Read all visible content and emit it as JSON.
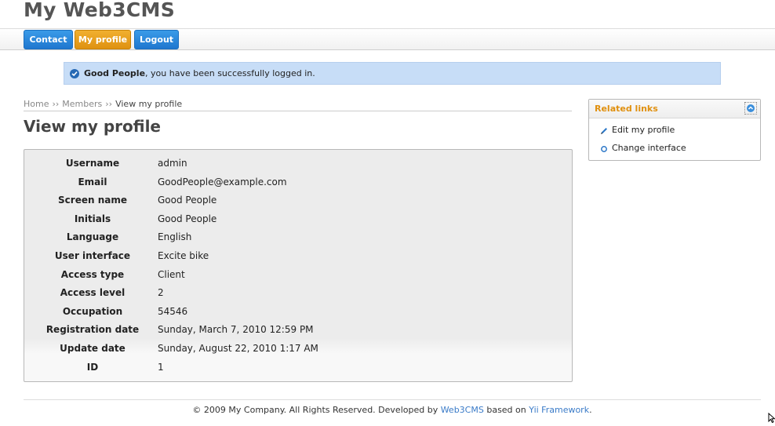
{
  "site": {
    "title": "My Web3CMS"
  },
  "menu": {
    "items": [
      "Contact",
      "My profile",
      "Logout"
    ]
  },
  "flash": {
    "name": "Good People",
    "message": ", you have been successfully logged in."
  },
  "breadcrumb": {
    "home": "Home",
    "members": "Members",
    "current": "View my profile",
    "separator": "››"
  },
  "page": {
    "title": "View my profile"
  },
  "profile": {
    "rows": [
      {
        "label": "Username",
        "value": "admin"
      },
      {
        "label": "Email",
        "value": "GoodPeople@example.com"
      },
      {
        "label": "Screen name",
        "value": "Good People"
      },
      {
        "label": "Initials",
        "value": "Good People"
      },
      {
        "label": "Language",
        "value": "English"
      },
      {
        "label": "User interface",
        "value": "Excite bike"
      },
      {
        "label": "Access type",
        "value": "Client"
      },
      {
        "label": "Access level",
        "value": "2"
      },
      {
        "label": "Occupation",
        "value": "54546"
      },
      {
        "label": "Registration date",
        "value": "Sunday, March 7, 2010 12:59 PM"
      },
      {
        "label": "Update date",
        "value": "Sunday, August 22, 2010 1:17 AM"
      },
      {
        "label": "ID",
        "value": "1"
      }
    ]
  },
  "sidebar": {
    "title": "Related links",
    "links": [
      {
        "label": "Edit my profile",
        "icon": "pencil-icon"
      },
      {
        "label": "Change interface",
        "icon": "circle-icon"
      }
    ]
  },
  "footer": {
    "prefix": "© 2009 My Company. All Rights Reserved. Developed by ",
    "link1": "Web3CMS",
    "middle": " based on ",
    "link2": "Yii Framework",
    "suffix": "."
  },
  "colors": {
    "menu_blue": "#1f77cf",
    "menu_active": "#df9110",
    "flash_bg": "#c7ddf7",
    "sidebar_title": "#e0900f",
    "link": "#3a7bc8"
  }
}
